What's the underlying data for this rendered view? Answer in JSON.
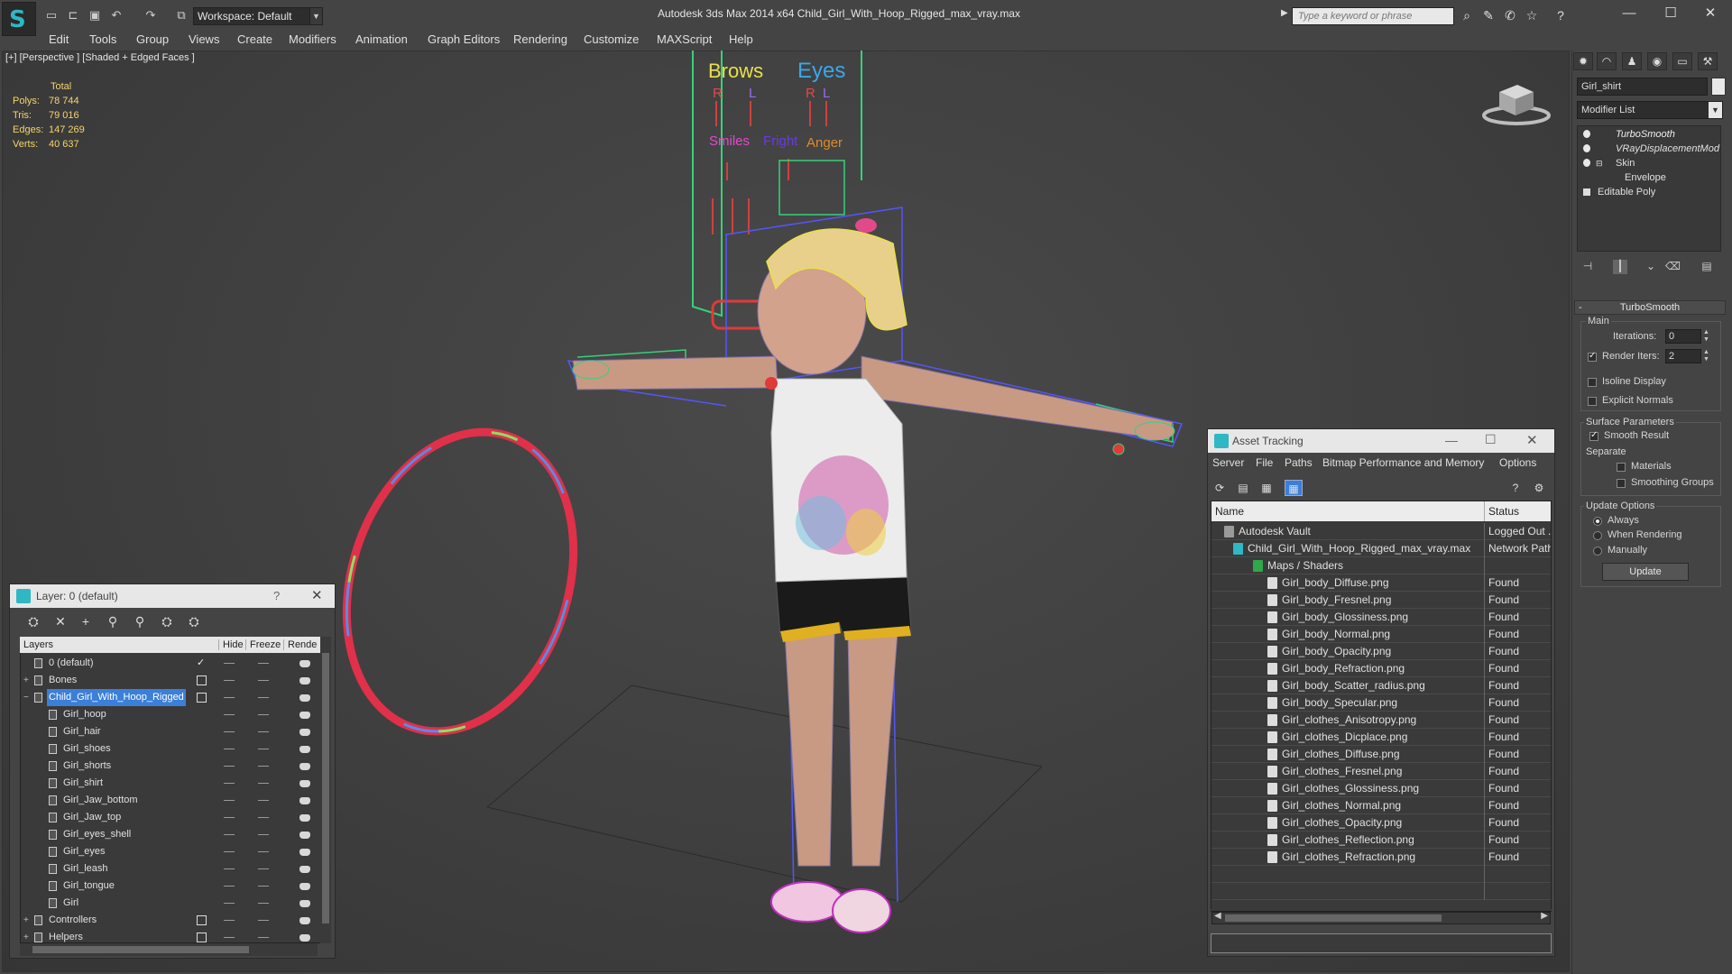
{
  "titlebar": {
    "workspace": "Workspace: Default",
    "window_title": "Autodesk 3ds Max  2014 x64       Child_Girl_With_Hoop_Rigged_max_vray.max",
    "search_placeholder": "Type a keyword or phrase"
  },
  "menu": [
    "Edit",
    "Tools",
    "Group",
    "Views",
    "Create",
    "Modifiers",
    "Animation",
    "Graph Editors",
    "Rendering",
    "Customize",
    "MAXScript",
    "Help"
  ],
  "viewport": {
    "label": "[+] [Perspective ] [Shaded + Edged Faces ]",
    "stats": {
      "header": "Total",
      "polys_label": "Polys:",
      "polys": "78 744",
      "tris_label": "Tris:",
      "tris": "79 016",
      "edges_label": "Edges:",
      "edges": "147 269",
      "verts_label": "Verts:",
      "verts": "40 637"
    },
    "rig_labels": {
      "brows": "Brows",
      "eyes": "Eyes",
      "smiles": "Smiles",
      "fright": "Fright",
      "anger": "Anger",
      "r1": "R",
      "l1": "L",
      "r2": "R",
      "l2": "L"
    }
  },
  "command_panel": {
    "object_name": "Girl_shirt",
    "modifier_list": "Modifier List",
    "stack": [
      "TurboSmooth",
      "VRayDisplacementMod",
      "Skin",
      "Envelope",
      "Editable Poly"
    ],
    "turbosmooth": {
      "title": "TurboSmooth",
      "main_label": "Main",
      "iterations_label": "Iterations:",
      "iterations": "0",
      "render_iters_label": "Render Iters:",
      "render_iters": "2",
      "isoline": "Isoline Display",
      "explicit_normals": "Explicit Normals",
      "surface_params": "Surface Parameters",
      "smooth_result": "Smooth Result",
      "separate": "Separate",
      "materials": "Materials",
      "smoothing_groups": "Smoothing Groups",
      "update_options": "Update Options",
      "always": "Always",
      "when_rendering": "When Rendering",
      "manually": "Manually",
      "update_btn": "Update"
    }
  },
  "layer_explorer": {
    "title": "Layer: 0 (default)",
    "help": "?",
    "columns": [
      "Layers",
      "Hide",
      "Freeze",
      "Rende"
    ],
    "rows": [
      {
        "name": "0 (default)",
        "indent": 1,
        "expand": "",
        "check": "✓"
      },
      {
        "name": "Bones",
        "indent": 1,
        "expand": "+",
        "check": ""
      },
      {
        "name": "Child_Girl_With_Hoop_Rigged",
        "indent": 1,
        "expand": "−",
        "check": "",
        "selected": true
      },
      {
        "name": "Girl_hoop",
        "indent": 2,
        "expand": "",
        "check": ""
      },
      {
        "name": "Girl_hair",
        "indent": 2,
        "expand": "",
        "check": ""
      },
      {
        "name": "Girl_shoes",
        "indent": 2,
        "expand": "",
        "check": ""
      },
      {
        "name": "Girl_shorts",
        "indent": 2,
        "expand": "",
        "check": ""
      },
      {
        "name": "Girl_shirt",
        "indent": 2,
        "expand": "",
        "check": ""
      },
      {
        "name": "Girl_Jaw_bottom",
        "indent": 2,
        "expand": "",
        "check": ""
      },
      {
        "name": "Girl_Jaw_top",
        "indent": 2,
        "expand": "",
        "check": ""
      },
      {
        "name": "Girl_eyes_shell",
        "indent": 2,
        "expand": "",
        "check": ""
      },
      {
        "name": "Girl_eyes",
        "indent": 2,
        "expand": "",
        "check": ""
      },
      {
        "name": "Girl_leash",
        "indent": 2,
        "expand": "",
        "check": ""
      },
      {
        "name": "Girl_tongue",
        "indent": 2,
        "expand": "",
        "check": ""
      },
      {
        "name": "Girl",
        "indent": 2,
        "expand": "",
        "check": ""
      },
      {
        "name": "Controllers",
        "indent": 1,
        "expand": "+",
        "check": ""
      },
      {
        "name": "Helpers",
        "indent": 1,
        "expand": "+",
        "check": ""
      }
    ]
  },
  "asset_tracking": {
    "title": "Asset Tracking",
    "menu": [
      "Server",
      "File",
      "Paths",
      "Bitmap Performance and Memory",
      "Options"
    ],
    "columns": [
      "Name",
      "Status"
    ],
    "rows": [
      {
        "name": "Autodesk Vault",
        "status": "Logged Out ...",
        "indent": 1
      },
      {
        "name": "Child_Girl_With_Hoop_Rigged_max_vray.max",
        "status": "Network Path",
        "indent": 2
      },
      {
        "name": "Maps / Shaders",
        "status": "",
        "indent": 3
      },
      {
        "name": "Girl_body_Diffuse.png",
        "status": "Found",
        "indent": 4
      },
      {
        "name": "Girl_body_Fresnel.png",
        "status": "Found",
        "indent": 4
      },
      {
        "name": "Girl_body_Glossiness.png",
        "status": "Found",
        "indent": 4
      },
      {
        "name": "Girl_body_Normal.png",
        "status": "Found",
        "indent": 4
      },
      {
        "name": "Girl_body_Opacity.png",
        "status": "Found",
        "indent": 4
      },
      {
        "name": "Girl_body_Refraction.png",
        "status": "Found",
        "indent": 4
      },
      {
        "name": "Girl_body_Scatter_radius.png",
        "status": "Found",
        "indent": 4
      },
      {
        "name": "Girl_body_Specular.png",
        "status": "Found",
        "indent": 4
      },
      {
        "name": "Girl_clothes_Anisotropy.png",
        "status": "Found",
        "indent": 4
      },
      {
        "name": "Girl_clothes_Dicplace.png",
        "status": "Found",
        "indent": 4
      },
      {
        "name": "Girl_clothes_Diffuse.png",
        "status": "Found",
        "indent": 4
      },
      {
        "name": "Girl_clothes_Fresnel.png",
        "status": "Found",
        "indent": 4
      },
      {
        "name": "Girl_clothes_Glossiness.png",
        "status": "Found",
        "indent": 4
      },
      {
        "name": "Girl_clothes_Normal.png",
        "status": "Found",
        "indent": 4
      },
      {
        "name": "Girl_clothes_Opacity.png",
        "status": "Found",
        "indent": 4
      },
      {
        "name": "Girl_clothes_Reflection.png",
        "status": "Found",
        "indent": 4
      },
      {
        "name": "Girl_clothes_Refraction.png",
        "status": "Found",
        "indent": 4
      }
    ]
  },
  "colors": {
    "accent": "#2fb7c4",
    "stats_text": "#f5d56b",
    "selection": "#3b7fd9",
    "hoop": "#e0304a",
    "rig_wire": "#e8e04a"
  }
}
